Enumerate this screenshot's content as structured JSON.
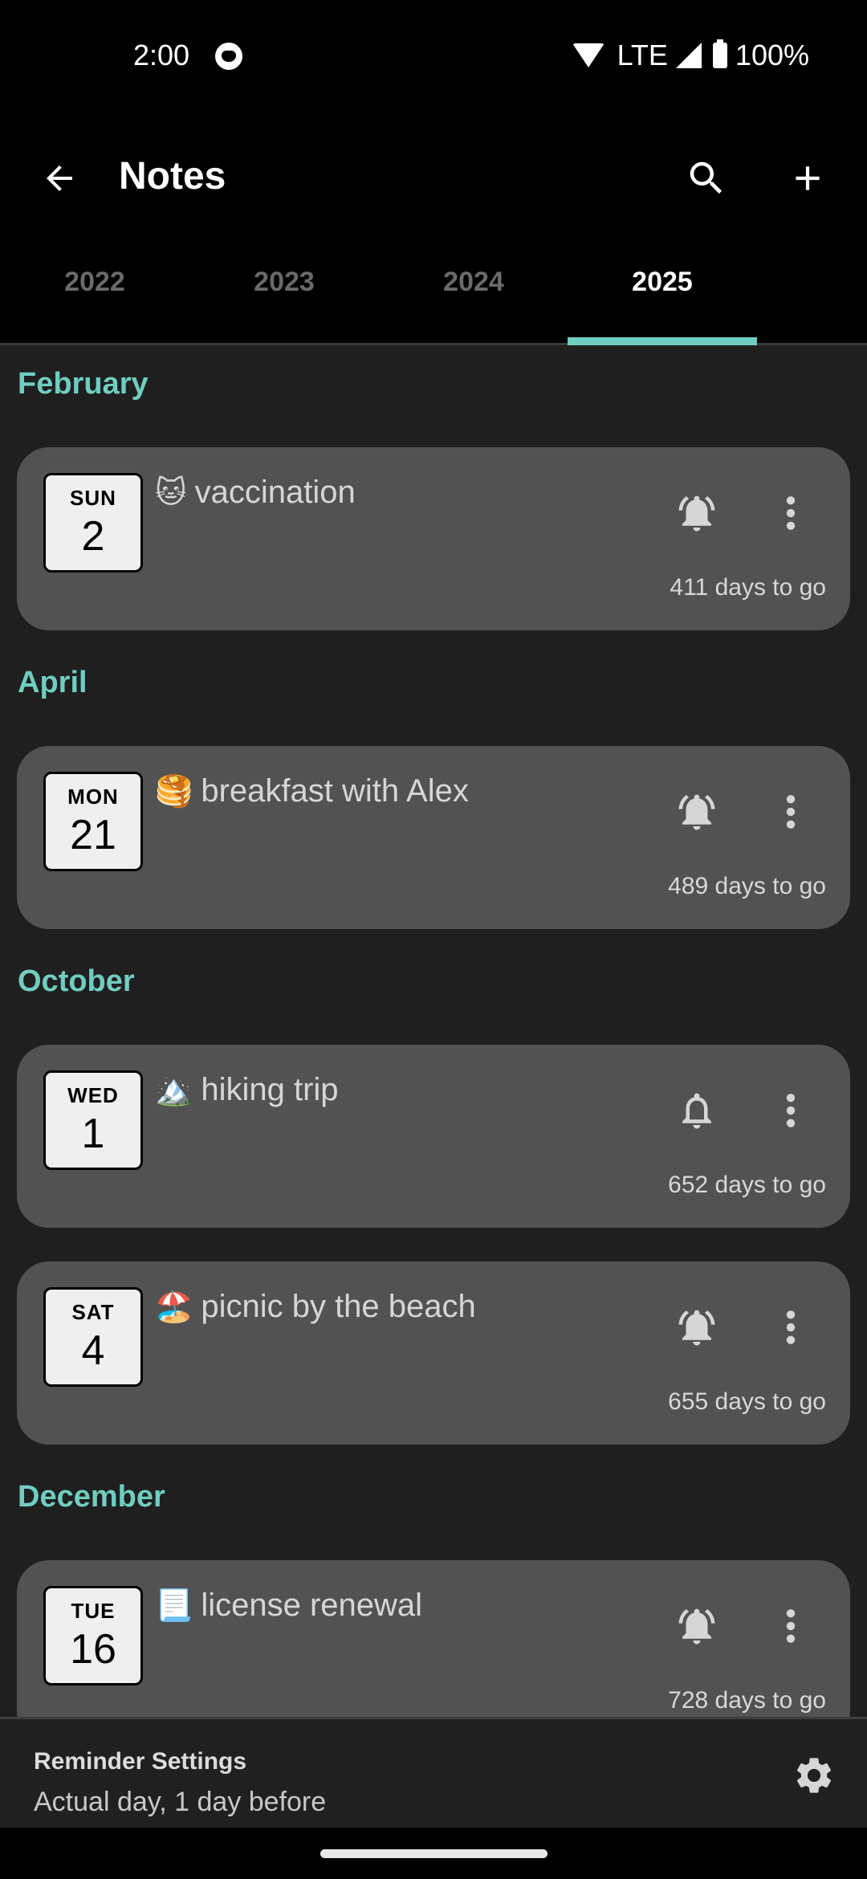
{
  "status_bar": {
    "time": "2:00",
    "network": "LTE",
    "battery": "100%",
    "icons": [
      "cat-notification-icon",
      "wifi-icon",
      "signal-icon",
      "battery-icon"
    ]
  },
  "app_bar": {
    "title": "Notes",
    "back_icon": "arrow-left-icon",
    "search_icon": "search-icon",
    "add_icon": "plus-icon"
  },
  "tabs": [
    {
      "label": "2022",
      "active": false
    },
    {
      "label": "2023",
      "active": false
    },
    {
      "label": "2024",
      "active": false
    },
    {
      "label": "2025",
      "active": true
    }
  ],
  "colors": {
    "accent": "#6fcdc1",
    "card_bg": "#525252",
    "list_bg": "#1f1f1f"
  },
  "sections": [
    {
      "month": "February",
      "notes": [
        {
          "dow": "SUN",
          "day": "2",
          "emoji": "🐱",
          "title": "vaccination",
          "days_to_go": "411 days to go",
          "reminder": "active"
        }
      ]
    },
    {
      "month": "April",
      "notes": [
        {
          "dow": "MON",
          "day": "21",
          "emoji": "🥞",
          "title": "breakfast with Alex",
          "days_to_go": "489 days to go",
          "reminder": "active"
        }
      ]
    },
    {
      "month": "October",
      "notes": [
        {
          "dow": "WED",
          "day": "1",
          "emoji": "🏔️",
          "title": "hiking trip",
          "days_to_go": "652 days to go",
          "reminder": "inactive"
        },
        {
          "dow": "SAT",
          "day": "4",
          "emoji": "🏖️",
          "title": "picnic by the beach",
          "days_to_go": "655 days to go",
          "reminder": "active"
        }
      ]
    },
    {
      "month": "December",
      "notes": [
        {
          "dow": "TUE",
          "day": "16",
          "emoji": "📃",
          "title": "license renewal",
          "days_to_go": "728 days to go",
          "reminder": "active"
        }
      ]
    }
  ],
  "reminder_settings": {
    "title": "Reminder Settings",
    "value": "Actual day, 1 day before",
    "icon": "gear-icon"
  }
}
